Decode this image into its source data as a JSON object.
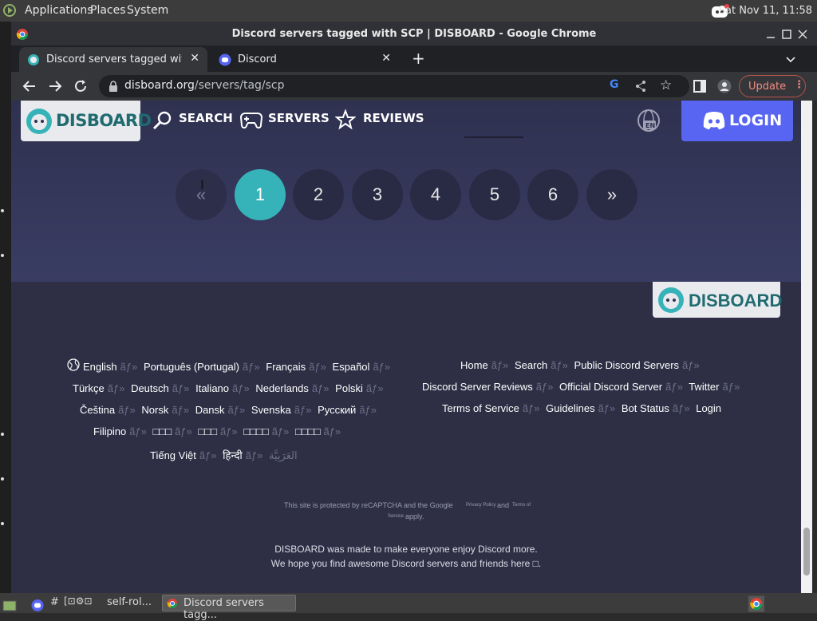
{
  "panel": {
    "menus": [
      "Applications",
      "Places",
      "System"
    ],
    "clock": "Sat Nov 11, 11:58"
  },
  "window": {
    "title": "Discord servers tagged with SCP | DISBOARD - Google Chrome"
  },
  "tabs": [
    {
      "label": "Discord servers tagged with SC",
      "active": true
    },
    {
      "label": "Discord",
      "active": false
    }
  ],
  "toolbar": {
    "url_host": "disboard.org",
    "url_path": "/servers/tag/scp",
    "update_label": "Update"
  },
  "site": {
    "logo_text": "DISBOARD",
    "nav": [
      "SEARCH",
      "SERVERS",
      "REVIEWS"
    ],
    "lang_badge": "EN",
    "login_label": "LOGIN"
  },
  "pagination": {
    "prev": "«",
    "pages": [
      "1",
      "2",
      "3",
      "4",
      "5",
      "6"
    ],
    "next": "»",
    "active_page": "1"
  },
  "footer": {
    "logo_text": "DISBOARD",
    "languages": [
      [
        "English",
        "Português (Portugal)",
        "Français",
        "Español"
      ],
      [
        "Türkçe",
        "Deutsch",
        "Italiano",
        "Nederlands",
        "Polski"
      ],
      [
        "Čeština",
        "Norsk",
        "Dansk",
        "Svenska",
        "Русский"
      ],
      [
        "Filipino",
        "□□□",
        "□□□",
        "□□□□",
        "□□□□"
      ],
      [
        "Tiếng Việt",
        "हिन्दी",
        "العَرَبِيَّة"
      ]
    ],
    "separator": "ãƒ»",
    "links": [
      [
        "Home",
        "Search",
        "Public Discord Servers"
      ],
      [
        "Discord Server Reviews",
        "Official Discord Server",
        "Twitter"
      ],
      [
        "Terms of Service",
        "Guidelines",
        "Bot Status",
        "Login"
      ]
    ],
    "recaptcha": "This site is protected by reCAPTCHA and the Google",
    "privacy": "Privacy Policy",
    "and": "and",
    "terms": "Terms of",
    "service": "Service",
    "apply": "apply.",
    "note1": "DISBOARD was made to make everyone enjoy Discord more.",
    "note2": "We hope you find awesome Discord servers and friends here □."
  },
  "taskbar": {
    "items": [
      "#",
      "self-rol...",
      "Discord servers tagg..."
    ]
  },
  "colors": {
    "accent_teal": "#36b3b8",
    "discord_blurple": "#5865f2",
    "page_bg": "#2f3150"
  }
}
